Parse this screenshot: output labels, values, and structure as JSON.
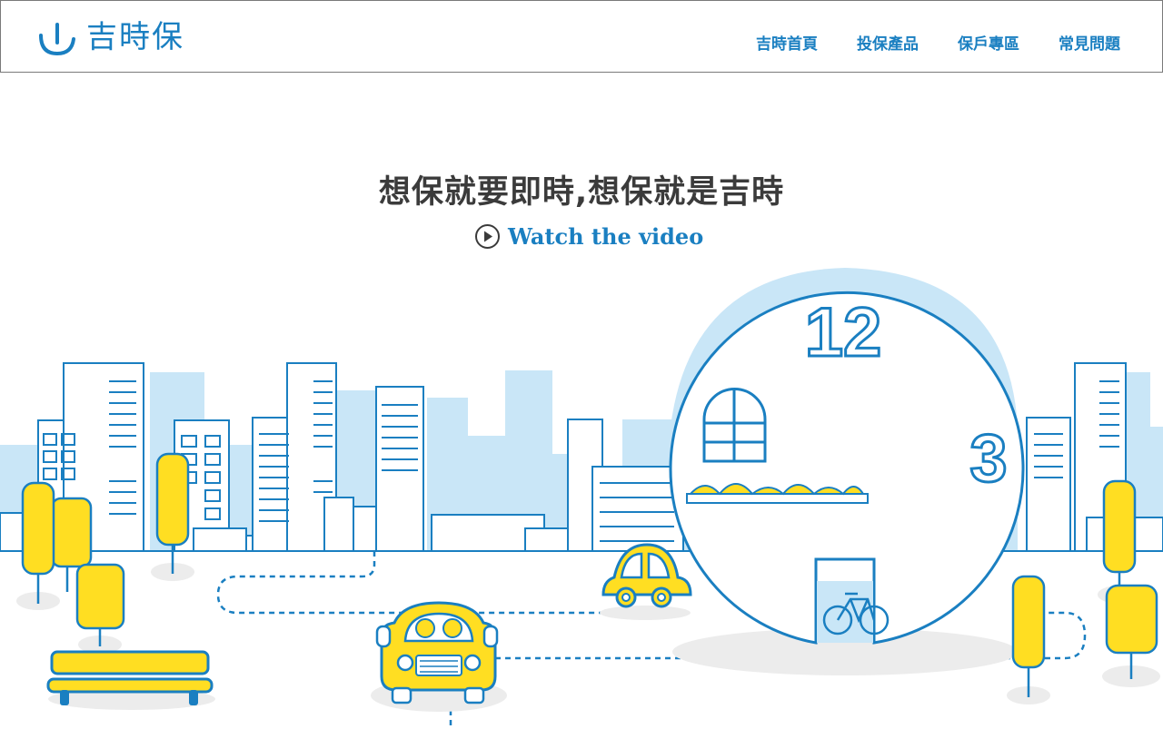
{
  "brand": {
    "name": "吉時保",
    "logo_icon": "clock-hand-icon",
    "color": "#1a7fc1"
  },
  "nav": {
    "items": [
      {
        "label": "吉時首頁"
      },
      {
        "label": "投保產品"
      },
      {
        "label": "保戶專區"
      },
      {
        "label": "常見問題"
      }
    ]
  },
  "hero": {
    "title": "想保就要即時,想保就是吉時",
    "video_label": "Watch the video",
    "video_icon": "play-circle-icon"
  },
  "clock": {
    "numbers": [
      "12",
      "3"
    ]
  },
  "colors": {
    "accent": "#1a7fc1",
    "sky": "#c9e6f7",
    "yellow": "#ffde22",
    "text": "#3b3b3b"
  }
}
